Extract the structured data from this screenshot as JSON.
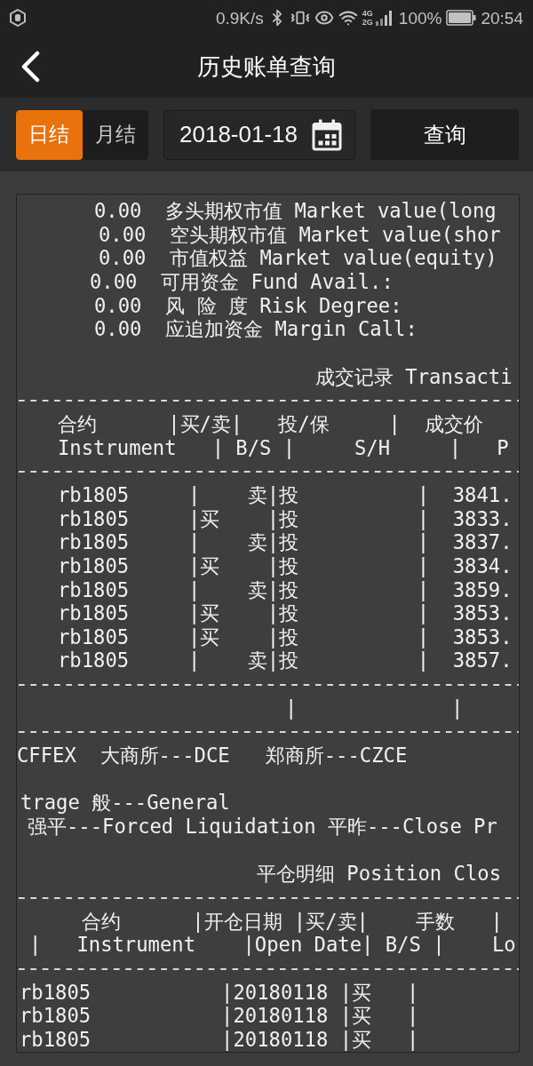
{
  "status_bar": {
    "net_speed": "0.9K/s",
    "network": [
      "4G",
      "2G"
    ],
    "battery": "100%",
    "time": "20:54"
  },
  "header": {
    "title": "历史账单查询"
  },
  "filter": {
    "periods": [
      {
        "label": "日结",
        "selected": true
      },
      {
        "label": "月结",
        "selected": false
      }
    ],
    "date": {
      "value": "2018-01-18"
    },
    "query_button": "查询"
  },
  "report": {
    "lines": [
      {
        "kind": "summary",
        "text": "0.00  多头期权市值 Market value(long"
      },
      {
        "kind": "summary",
        "text": "0.00  空头期权市值 Market value(shor"
      },
      {
        "kind": "summary",
        "text": "0.00  市值权益 Market value(equity)"
      },
      {
        "kind": "summary",
        "text": "0.00  可用资金 Fund Avail.:"
      },
      {
        "kind": "summary",
        "text": "0.00  风 险 度 Risk Degree:"
      },
      {
        "kind": "summary",
        "text": "0.00  应追加资金 Margin Call:"
      },
      {
        "kind": "blank"
      },
      {
        "kind": "title",
        "text": "成交记录 Transacti"
      },
      {
        "kind": "rule"
      },
      {
        "kind": "header",
        "text": "合约      |买/卖|   投/保     |  成交价"
      },
      {
        "kind": "header",
        "text": "Instrument   | B/S |     S/H     |   P"
      },
      {
        "kind": "rule"
      },
      {
        "kind": "row",
        "text": "rb1805     |    卖|投          |  3841."
      },
      {
        "kind": "row",
        "text": "rb1805     |买    |投          |  3833."
      },
      {
        "kind": "row",
        "text": "rb1805     |    卖|投          |  3837."
      },
      {
        "kind": "row",
        "text": "rb1805     |买    |投          |  3834."
      },
      {
        "kind": "row",
        "text": "rb1805     |    卖|投          |  3859."
      },
      {
        "kind": "row",
        "text": "rb1805     |买    |投          |  3853."
      },
      {
        "kind": "row",
        "text": "rb1805     |买    |投          |  3853."
      },
      {
        "kind": "row",
        "text": "rb1805     |    卖|投          |  3857."
      },
      {
        "kind": "rule"
      },
      {
        "kind": "row",
        "text": "|             |"
      },
      {
        "kind": "rule"
      },
      {
        "kind": "note",
        "text": "CFFEX  大商所---DCE   郑商所---CZCE"
      },
      {
        "kind": "blank"
      },
      {
        "kind": "note",
        "text": "trage 般---General"
      },
      {
        "kind": "note",
        "text": "强平---Forced Liquidation 平昨---Close Pr"
      },
      {
        "kind": "blank"
      },
      {
        "kind": "title",
        "text": "平仓明细 Position Clos"
      },
      {
        "kind": "rule"
      },
      {
        "kind": "header",
        "text": "合约      |开仓日期 |买/卖|    手数   |"
      },
      {
        "kind": "header",
        "text": "|   Instrument    |Open Date| B/S |    Lo"
      },
      {
        "kind": "rule"
      },
      {
        "kind": "row",
        "text": "rb1805           |20180118 |买   |"
      },
      {
        "kind": "row",
        "text": "rb1805           |20180118 |买   |"
      },
      {
        "kind": "row",
        "text": "rb1805           |20180118 |买   |"
      }
    ]
  }
}
